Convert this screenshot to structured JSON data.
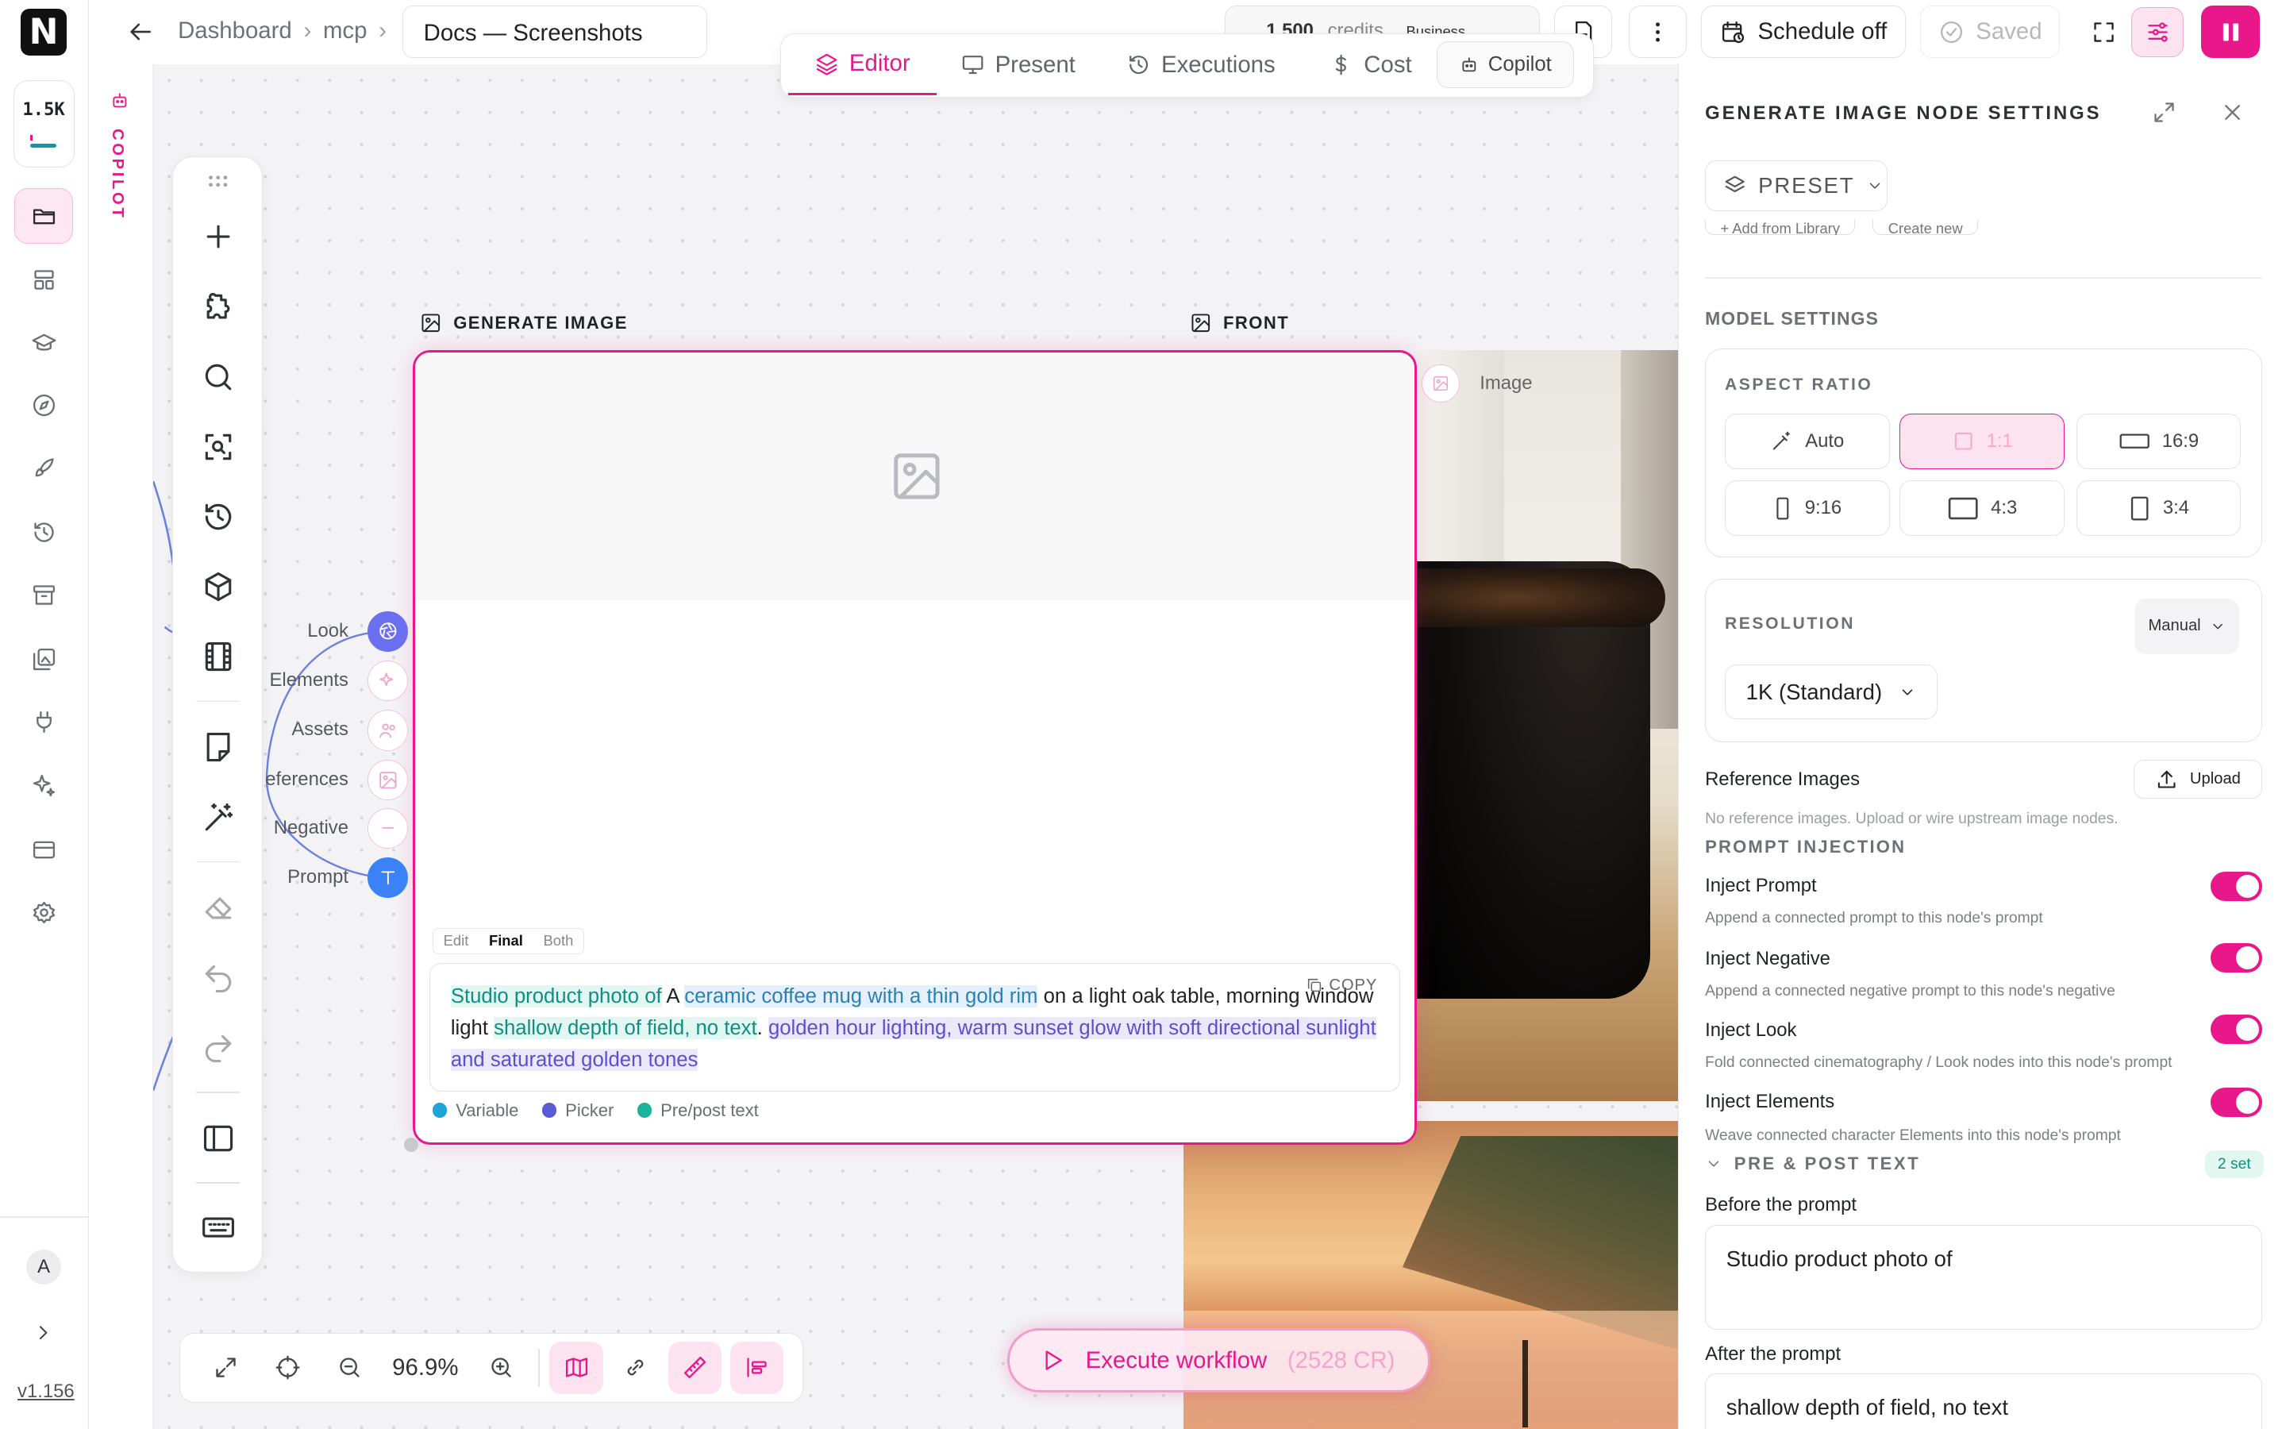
{
  "app": {
    "logo": "N",
    "credits_compact": "1.5K",
    "version": "v1.156",
    "avatar_initial": "A"
  },
  "copilot_strip": {
    "label": "COPILOT"
  },
  "topbar": {
    "breadcrumb": [
      "Dashboard",
      "mcp"
    ],
    "doc_title": "Docs — Screenshots",
    "credit_pill": {
      "value": "1,500",
      "unit": "credits",
      "plan": "Business"
    },
    "schedule_label": "Schedule off",
    "saved_label": "Saved"
  },
  "tabs": [
    {
      "label": "Editor",
      "icon": "layers-icon",
      "active": true
    },
    {
      "label": "Present",
      "icon": "monitor-icon"
    },
    {
      "label": "Executions",
      "icon": "history-icon"
    },
    {
      "label": "Cost",
      "icon": "dollar-icon"
    }
  ],
  "copilot_tab": {
    "label": "Copilot"
  },
  "node": {
    "title": "GENERATE IMAGE",
    "front_title": "FRONT",
    "ports": [
      "Look",
      "Elements",
      "Assets",
      "eferences",
      "Negative",
      "Prompt"
    ],
    "segments": [
      "Edit",
      "Final",
      "Both"
    ],
    "active_segment": "Final",
    "prompt": {
      "var_before": "Studio product photo of",
      "text1": " A ",
      "picker": "ceramic coffee mug with a thin gold rim",
      "text2": " on a light oak table, morning window light ",
      "var_after": "shallow depth of field, no text",
      "text3": ". ",
      "style": "golden hour lighting, warm sunset glow with soft directional sunlight and saturated golden tones"
    },
    "copy_label": "COPY",
    "legend": [
      {
        "label": "Variable",
        "color": "#1aa6d9"
      },
      {
        "label": "Picker",
        "color": "#5b5bd6"
      },
      {
        "label": "Pre/post text",
        "color": "#1bb39a"
      }
    ],
    "image_chip_label": "Image"
  },
  "canvas_controls": {
    "zoom": "96.9%"
  },
  "execute": {
    "label": "Execute workflow",
    "cost": "(2528 CR)"
  },
  "panel": {
    "title": "GENERATE IMAGE NODE SETTINGS",
    "preset_label": "PRESET",
    "hidden_row": [
      "+ Add from Library",
      "Create new"
    ],
    "model_settings_label": "MODEL SETTINGS",
    "aspect_ratio_label": "ASPECT RATIO",
    "aspect_ratios": [
      "Auto",
      "1:1",
      "16:9",
      "9:16",
      "4:3",
      "3:4"
    ],
    "selected_aspect_ratio": "1:1",
    "resolution_label": "RESOLUTION",
    "resolution_mode": "Manual",
    "resolution_value": "1K (Standard)",
    "reference_images_label": "Reference Images",
    "upload_label": "Upload",
    "reference_images_hint": "No reference images. Upload or wire upstream image nodes.",
    "prompt_injection_label": "PROMPT INJECTION",
    "injections": [
      {
        "title": "Inject Prompt",
        "desc": "Append a connected prompt to this node's prompt",
        "on": true
      },
      {
        "title": "Inject Negative",
        "desc": "Append a connected negative prompt to this node's negative",
        "on": true
      },
      {
        "title": "Inject Look",
        "desc": "Fold connected cinematography / Look nodes into this node's prompt",
        "on": true
      },
      {
        "title": "Inject Elements",
        "desc": "Weave connected character Elements into this node's prompt",
        "on": true
      }
    ],
    "pre_post_label": "PRE & POST TEXT",
    "pre_post_badge": "2 set",
    "before_label": "Before the prompt",
    "before_value": "Studio product photo of",
    "after_label": "After the prompt",
    "after_value": "shallow depth of field, no text"
  },
  "colors": {
    "accent": "#e8188a",
    "teal": "#0a9aa8",
    "indigo": "#6c6ff0"
  }
}
